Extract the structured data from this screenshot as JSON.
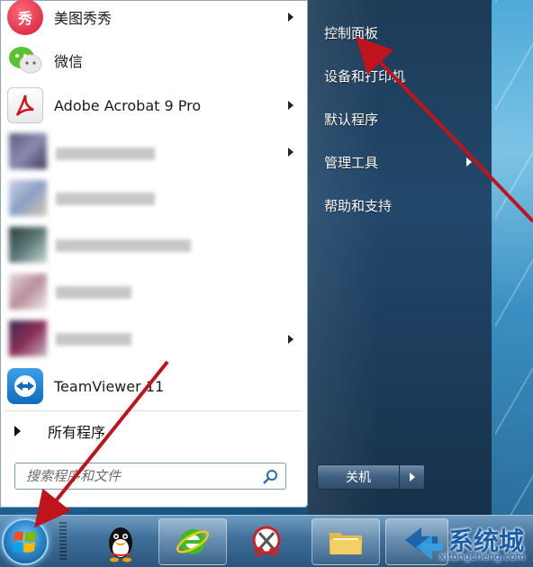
{
  "start_menu": {
    "pinned": [
      {
        "label": "美图秀秀",
        "has_submenu": true,
        "icon": "meitu-icon"
      },
      {
        "label": "微信",
        "has_submenu": false,
        "icon": "wechat-icon"
      },
      {
        "label": "Adobe Acrobat 9 Pro",
        "has_submenu": true,
        "icon": "acrobat-icon"
      },
      {
        "label": "",
        "has_submenu": true,
        "icon": "blurred-icon"
      },
      {
        "label": "",
        "has_submenu": false,
        "icon": "blurred-icon"
      },
      {
        "label": "",
        "has_submenu": false,
        "icon": "blurred-icon"
      },
      {
        "label": "",
        "has_submenu": false,
        "icon": "blurred-icon"
      },
      {
        "label": "",
        "has_submenu": true,
        "icon": "blurred-icon"
      },
      {
        "label": "TeamViewer 11",
        "has_submenu": false,
        "icon": "teamviewer-icon"
      }
    ],
    "all_programs": "所有程序",
    "search": {
      "placeholder": "搜索程序和文件"
    },
    "right_items": [
      {
        "label": "控制面板",
        "has_submenu": false
      },
      {
        "label": "设备和打印机",
        "has_submenu": false
      },
      {
        "label": "默认程序",
        "has_submenu": false
      },
      {
        "label": "管理工具",
        "has_submenu": true
      },
      {
        "label": "帮助和支持",
        "has_submenu": false
      }
    ],
    "shutdown_label": "关机"
  },
  "taskbar": {
    "buttons": [
      "qq-icon",
      "ie-icon",
      "snipping-tool-icon",
      "file-explorer-icon",
      "network-icon"
    ]
  },
  "watermark": {
    "text": "系统城",
    "url": "xitongcheng.com"
  },
  "colors": {
    "annotation_arrow": "#c0141c",
    "right_pane": "#1f4163",
    "taskbar": "#3e6f9a"
  }
}
